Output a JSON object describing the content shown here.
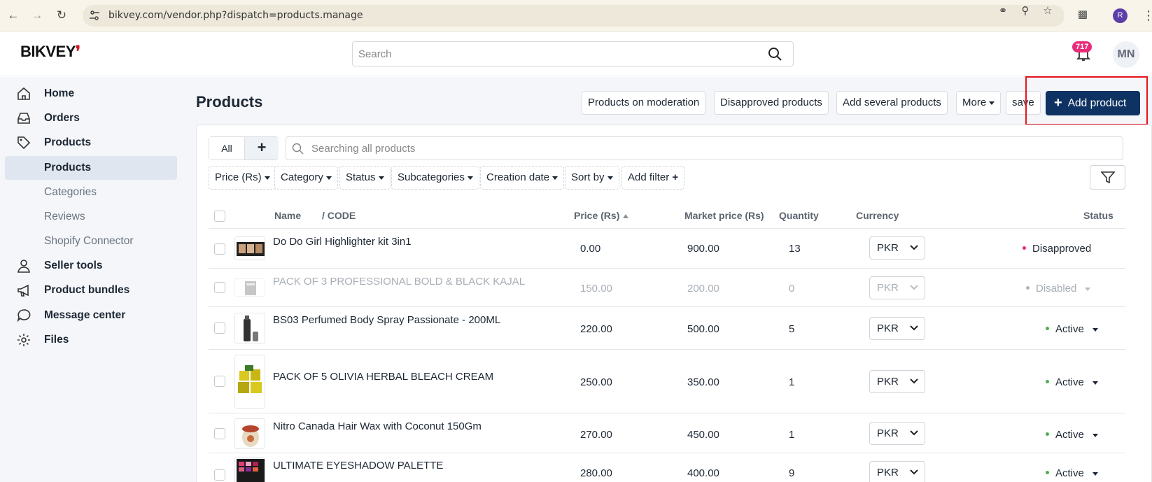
{
  "browser": {
    "url": "bikvey.com/vendor.php?dispatch=products.manage",
    "profile_initial": "R"
  },
  "header": {
    "logo_text": "BIKVEY",
    "search_placeholder": "Search",
    "notification_count": "717",
    "avatar_initials": "MN"
  },
  "sidebar": {
    "items": [
      {
        "label": "Home",
        "icon": "home-icon"
      },
      {
        "label": "Orders",
        "icon": "inbox-icon"
      },
      {
        "label": "Products",
        "icon": "tag-icon"
      },
      {
        "label": "Products",
        "sub": true,
        "active": true
      },
      {
        "label": "Categories",
        "sub": true
      },
      {
        "label": "Reviews",
        "sub": true
      },
      {
        "label": "Shopify Connector",
        "sub": true
      },
      {
        "label": "Seller tools",
        "icon": "user-icon"
      },
      {
        "label": "Product bundles",
        "icon": "megaphone-icon"
      },
      {
        "label": "Message center",
        "icon": "chat-bubble-icon"
      },
      {
        "label": "Files",
        "icon": "gear-icon"
      }
    ]
  },
  "page": {
    "title": "Products",
    "toolbar": {
      "moderation": "Products on moderation",
      "disapproved": "Disapproved products",
      "add_several": "Add several products",
      "more": "More",
      "save": "save",
      "add_product": "Add product"
    },
    "tabs": {
      "all": "All",
      "add": "+"
    },
    "product_search_placeholder": "Searching all products",
    "filters": {
      "price": "Price (Rs)",
      "category": "Category",
      "status": "Status",
      "subcategories": "Subcategories",
      "creation_date": "Creation date",
      "sort_by": "Sort by",
      "add_filter": "Add filter"
    },
    "table": {
      "columns": {
        "name": "Name",
        "code": "/ CODE",
        "price": "Price (Rs)",
        "market_price": "Market price (Rs)",
        "quantity": "Quantity",
        "currency": "Currency",
        "status": "Status"
      },
      "rows": [
        {
          "name": "Do Do Girl Highlighter kit 3in1",
          "price": "0.00",
          "market_price": "900.00",
          "quantity": "13",
          "currency": "PKR",
          "status": "Disapproved",
          "status_color": "#e82b7a",
          "disabled": false
        },
        {
          "name": "PACK OF 3 PROFESSIONAL BOLD & BLACK KAJAL",
          "price": "150.00",
          "market_price": "200.00",
          "quantity": "0",
          "currency": "PKR",
          "status": "Disabled",
          "status_color": "#b0b5bb",
          "disabled": true
        },
        {
          "name": "BS03 Perfumed Body Spray Passionate - 200ML",
          "price": "220.00",
          "market_price": "500.00",
          "quantity": "5",
          "currency": "PKR",
          "status": "Active",
          "status_color": "#4caf50",
          "disabled": false
        },
        {
          "name": "PACK OF 5 OLIVIA HERBAL BLEACH CREAM",
          "price": "250.00",
          "market_price": "350.00",
          "quantity": "1",
          "currency": "PKR",
          "status": "Active",
          "status_color": "#4caf50",
          "disabled": false
        },
        {
          "name": "Nitro Canada Hair Wax with Coconut 150Gm",
          "price": "270.00",
          "market_price": "450.00",
          "quantity": "1",
          "currency": "PKR",
          "status": "Active",
          "status_color": "#4caf50",
          "disabled": false
        },
        {
          "name": "ULTIMATE EYESHADOW PALETTE",
          "price": "280.00",
          "market_price": "400.00",
          "quantity": "9",
          "currency": "PKR",
          "status": "Active",
          "status_color": "#4caf50",
          "disabled": false
        }
      ]
    }
  },
  "colors": {
    "primary": "#0e3262",
    "highlight_box": "#e8141b",
    "active_status": "#4caf50",
    "disapproved_status": "#e82b7a",
    "badge": "#e82b7a"
  }
}
